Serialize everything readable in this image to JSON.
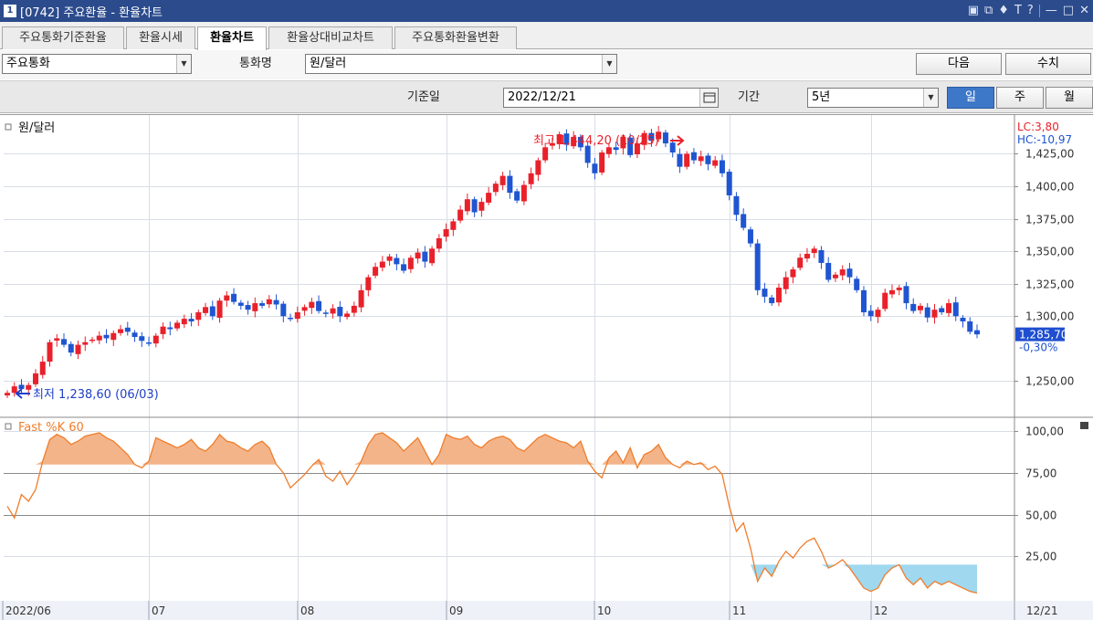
{
  "window": {
    "number": "1",
    "title": "[0742] 주요환율 - 환율차트"
  },
  "tabs": [
    {
      "label": "주요통화기준환율",
      "active": false
    },
    {
      "label": "환율시세",
      "active": false
    },
    {
      "label": "환율차트",
      "active": true
    },
    {
      "label": "환율상대비교차트",
      "active": false
    },
    {
      "label": "주요통화환율변환",
      "active": false
    }
  ],
  "controls": {
    "category_value": "주요통화",
    "currency_label": "통화명",
    "currency_value": "원/달러",
    "next_button": "다음",
    "data_button": "수치",
    "base_date_label": "기준일",
    "base_date_value": "2022/12/21",
    "period_label": "기간",
    "period_value": "5년",
    "interval_day": "일",
    "interval_week": "주",
    "interval_month": "월",
    "active_interval": "일"
  },
  "colors": {
    "up": "#e8212b",
    "down": "#1f55d1",
    "stoch_line": "#f07d2a",
    "stoch_fill_high": "#f3b48a",
    "stoch_fill_low": "#9fd8ef",
    "price_tag_bg": "#1f4fd0"
  },
  "chart_data": [
    {
      "type": "candlestick",
      "title": "원/달러",
      "y_ticks": [
        1425,
        1400,
        1375,
        1350,
        1325,
        1300,
        1250
      ],
      "y_tick_labels": [
        "1,425,00",
        "1,400,00",
        "1,375,00",
        "1,350,00",
        "1,325,00",
        "1,300,00",
        "1,250,00"
      ],
      "ylim": [
        1225,
        1452
      ],
      "x_labels": [
        "2022/06",
        "07",
        "08",
        "09",
        "10",
        "11",
        "12"
      ],
      "x_label_index": [
        0,
        20,
        41,
        62,
        83,
        102,
        122
      ],
      "last_date_label": "12/21",
      "legend_right": {
        "lc": "LC:3,80",
        "hc": "HC:-10,97"
      },
      "current_price_label": "1,285,70",
      "current_change_label": "-0,30%",
      "current_price": 1285.7,
      "high_annotation": "최고 1,444,20 (10/25)",
      "high_value": 1444.2,
      "low_annotation": "최저 1,238,60 (06/03)",
      "low_value": 1238.6,
      "close": [
        1241,
        1246,
        1244,
        1247,
        1256,
        1265,
        1280,
        1283,
        1278,
        1272,
        1278,
        1280,
        1282,
        1285,
        1283,
        1287,
        1290,
        1288,
        1284,
        1281,
        1279,
        1285,
        1292,
        1290,
        1295,
        1298,
        1296,
        1303,
        1307,
        1300,
        1312,
        1316,
        1311,
        1308,
        1305,
        1310,
        1308,
        1313,
        1309,
        1300,
        1298,
        1303,
        1307,
        1311,
        1304,
        1302,
        1306,
        1300,
        1302,
        1308,
        1320,
        1330,
        1338,
        1342,
        1346,
        1340,
        1335,
        1345,
        1349,
        1342,
        1352,
        1360,
        1367,
        1373,
        1382,
        1390,
        1380,
        1388,
        1395,
        1402,
        1408,
        1395,
        1389,
        1401,
        1410,
        1420,
        1430,
        1433,
        1440,
        1432,
        1438,
        1430,
        1418,
        1410,
        1426,
        1430,
        1428,
        1438,
        1424,
        1433,
        1441,
        1435,
        1442,
        1433,
        1426,
        1415,
        1425,
        1420,
        1423,
        1417,
        1420,
        1410,
        1393,
        1378,
        1368,
        1356,
        1320,
        1315,
        1310,
        1322,
        1330,
        1336,
        1345,
        1348,
        1352,
        1341,
        1328,
        1332,
        1336,
        1330,
        1320,
        1303,
        1300,
        1305,
        1318,
        1320,
        1322,
        1310,
        1304,
        1308,
        1299,
        1305,
        1303,
        1310,
        1300,
        1296,
        1288,
        1286
      ],
      "indicator": {
        "name": "Fast %K 60",
        "y_ticks": [
          100,
          75,
          50,
          25
        ],
        "y_tick_labels": [
          "100,00",
          "75,00",
          "50,00",
          "25,00"
        ],
        "ylim": [
          0,
          105
        ],
        "overbought": 80,
        "oversold": 20,
        "values": [
          55,
          48,
          62,
          58,
          65,
          82,
          95,
          98,
          96,
          92,
          94,
          97,
          98,
          99,
          96,
          94,
          90,
          86,
          80,
          78,
          82,
          96,
          94,
          92,
          90,
          92,
          95,
          90,
          88,
          92,
          98,
          94,
          93,
          90,
          88,
          92,
          94,
          90,
          80,
          75,
          66,
          70,
          74,
          79,
          83,
          73,
          70,
          76,
          68,
          74,
          82,
          92,
          98,
          99,
          96,
          93,
          88,
          92,
          96,
          88,
          80,
          86,
          98,
          96,
          95,
          97,
          92,
          90,
          94,
          96,
          97,
          95,
          90,
          88,
          92,
          96,
          98,
          96,
          94,
          93,
          90,
          94,
          82,
          76,
          72,
          84,
          88,
          81,
          90,
          78,
          86,
          88,
          92,
          84,
          80,
          78,
          82,
          80,
          81,
          77,
          79,
          74,
          55,
          40,
          45,
          30,
          10,
          18,
          13,
          22,
          28,
          24,
          30,
          34,
          36,
          28,
          18,
          20,
          23,
          18,
          12,
          6,
          4,
          6,
          14,
          18,
          20,
          12,
          8,
          12,
          6,
          10,
          8,
          10,
          8,
          6,
          4,
          3
        ]
      }
    }
  ]
}
